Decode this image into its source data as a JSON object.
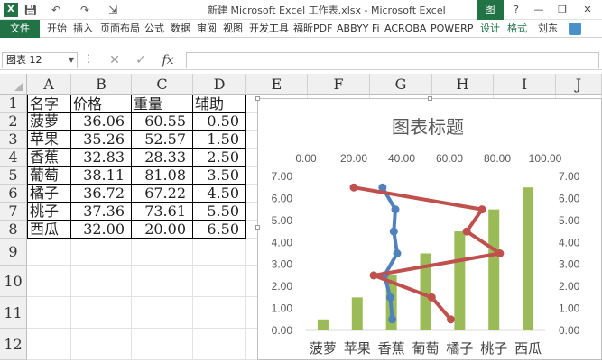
{
  "titlebar": {
    "title": "新建 Microsoft Excel 工作表.xlsx - Microsoft Excel",
    "chart_tools_label": "图表...",
    "help": "?",
    "minimize": "—",
    "restore": "❐",
    "close": "✕"
  },
  "tabs": {
    "file": "文件",
    "items": [
      "开始",
      "插入",
      "页面布局",
      "公式",
      "数据",
      "审阅",
      "视图",
      "开发工具",
      "福昕PDF",
      "ABBYY Fi",
      "ACROBA",
      "POWERP",
      "设计",
      "格式"
    ],
    "user": "刘东"
  },
  "formula_bar": {
    "name_box": "图表 12",
    "formula": ""
  },
  "grid": {
    "columns": [
      "A",
      "B",
      "C",
      "D",
      "E",
      "F",
      "G",
      "H",
      "I",
      "J"
    ],
    "rows": [
      "1",
      "2",
      "3",
      "4",
      "5",
      "6",
      "7",
      "8",
      "9",
      "10",
      "11",
      "12"
    ],
    "header": [
      "名字",
      "价格",
      "重量",
      "辅助"
    ],
    "data": [
      [
        "菠萝",
        "36.06",
        "60.55",
        "0.50"
      ],
      [
        "苹果",
        "35.26",
        "52.57",
        "1.50"
      ],
      [
        "香蕉",
        "32.83",
        "28.33",
        "2.50"
      ],
      [
        "葡萄",
        "38.11",
        "81.08",
        "3.50"
      ],
      [
        "橘子",
        "36.72",
        "67.22",
        "4.50"
      ],
      [
        "桃子",
        "37.36",
        "73.61",
        "5.50"
      ],
      [
        "西瓜",
        "32.00",
        "20.00",
        "6.50"
      ]
    ]
  },
  "chart_data": {
    "type": "bar",
    "title": "图表标题",
    "categories": [
      "菠萝",
      "苹果",
      "香蕉",
      "葡萄",
      "橘子",
      "桃子",
      "西瓜"
    ],
    "left_axis": {
      "min": 0,
      "max": 7,
      "step": 1,
      "ticks": [
        "0.00",
        "1.00",
        "2.00",
        "3.00",
        "4.00",
        "5.00",
        "6.00",
        "7.00"
      ]
    },
    "right_axis": {
      "min": 0,
      "max": 7,
      "step": 1,
      "ticks": [
        "0.00",
        "1.00",
        "2.00",
        "3.00",
        "4.00",
        "5.00",
        "6.00",
        "7.00"
      ]
    },
    "top_axis": {
      "min": 0,
      "max": 100,
      "step": 20,
      "ticks": [
        "0.00",
        "20.00",
        "40.00",
        "60.00",
        "80.00",
        "100.00"
      ]
    },
    "series": [
      {
        "kind": "bar",
        "values": [
          0.5,
          1.5,
          2.5,
          3.5,
          4.5,
          5.5,
          6.5
        ],
        "color": "#9bbb59"
      },
      {
        "kind": "line",
        "x": [
          36.06,
          35.26,
          32.83,
          38.11,
          36.72,
          37.36,
          32.0
        ],
        "y": [
          0.5,
          1.5,
          2.5,
          3.5,
          4.5,
          5.5,
          6.5
        ],
        "color": "#4f81bd"
      },
      {
        "kind": "line",
        "x": [
          60.55,
          52.57,
          28.33,
          81.08,
          67.22,
          73.61,
          20.0
        ],
        "y": [
          0.5,
          1.5,
          2.5,
          3.5,
          4.5,
          5.5,
          6.5
        ],
        "color": "#c0504d"
      }
    ],
    "grid": false,
    "legend": "none"
  }
}
